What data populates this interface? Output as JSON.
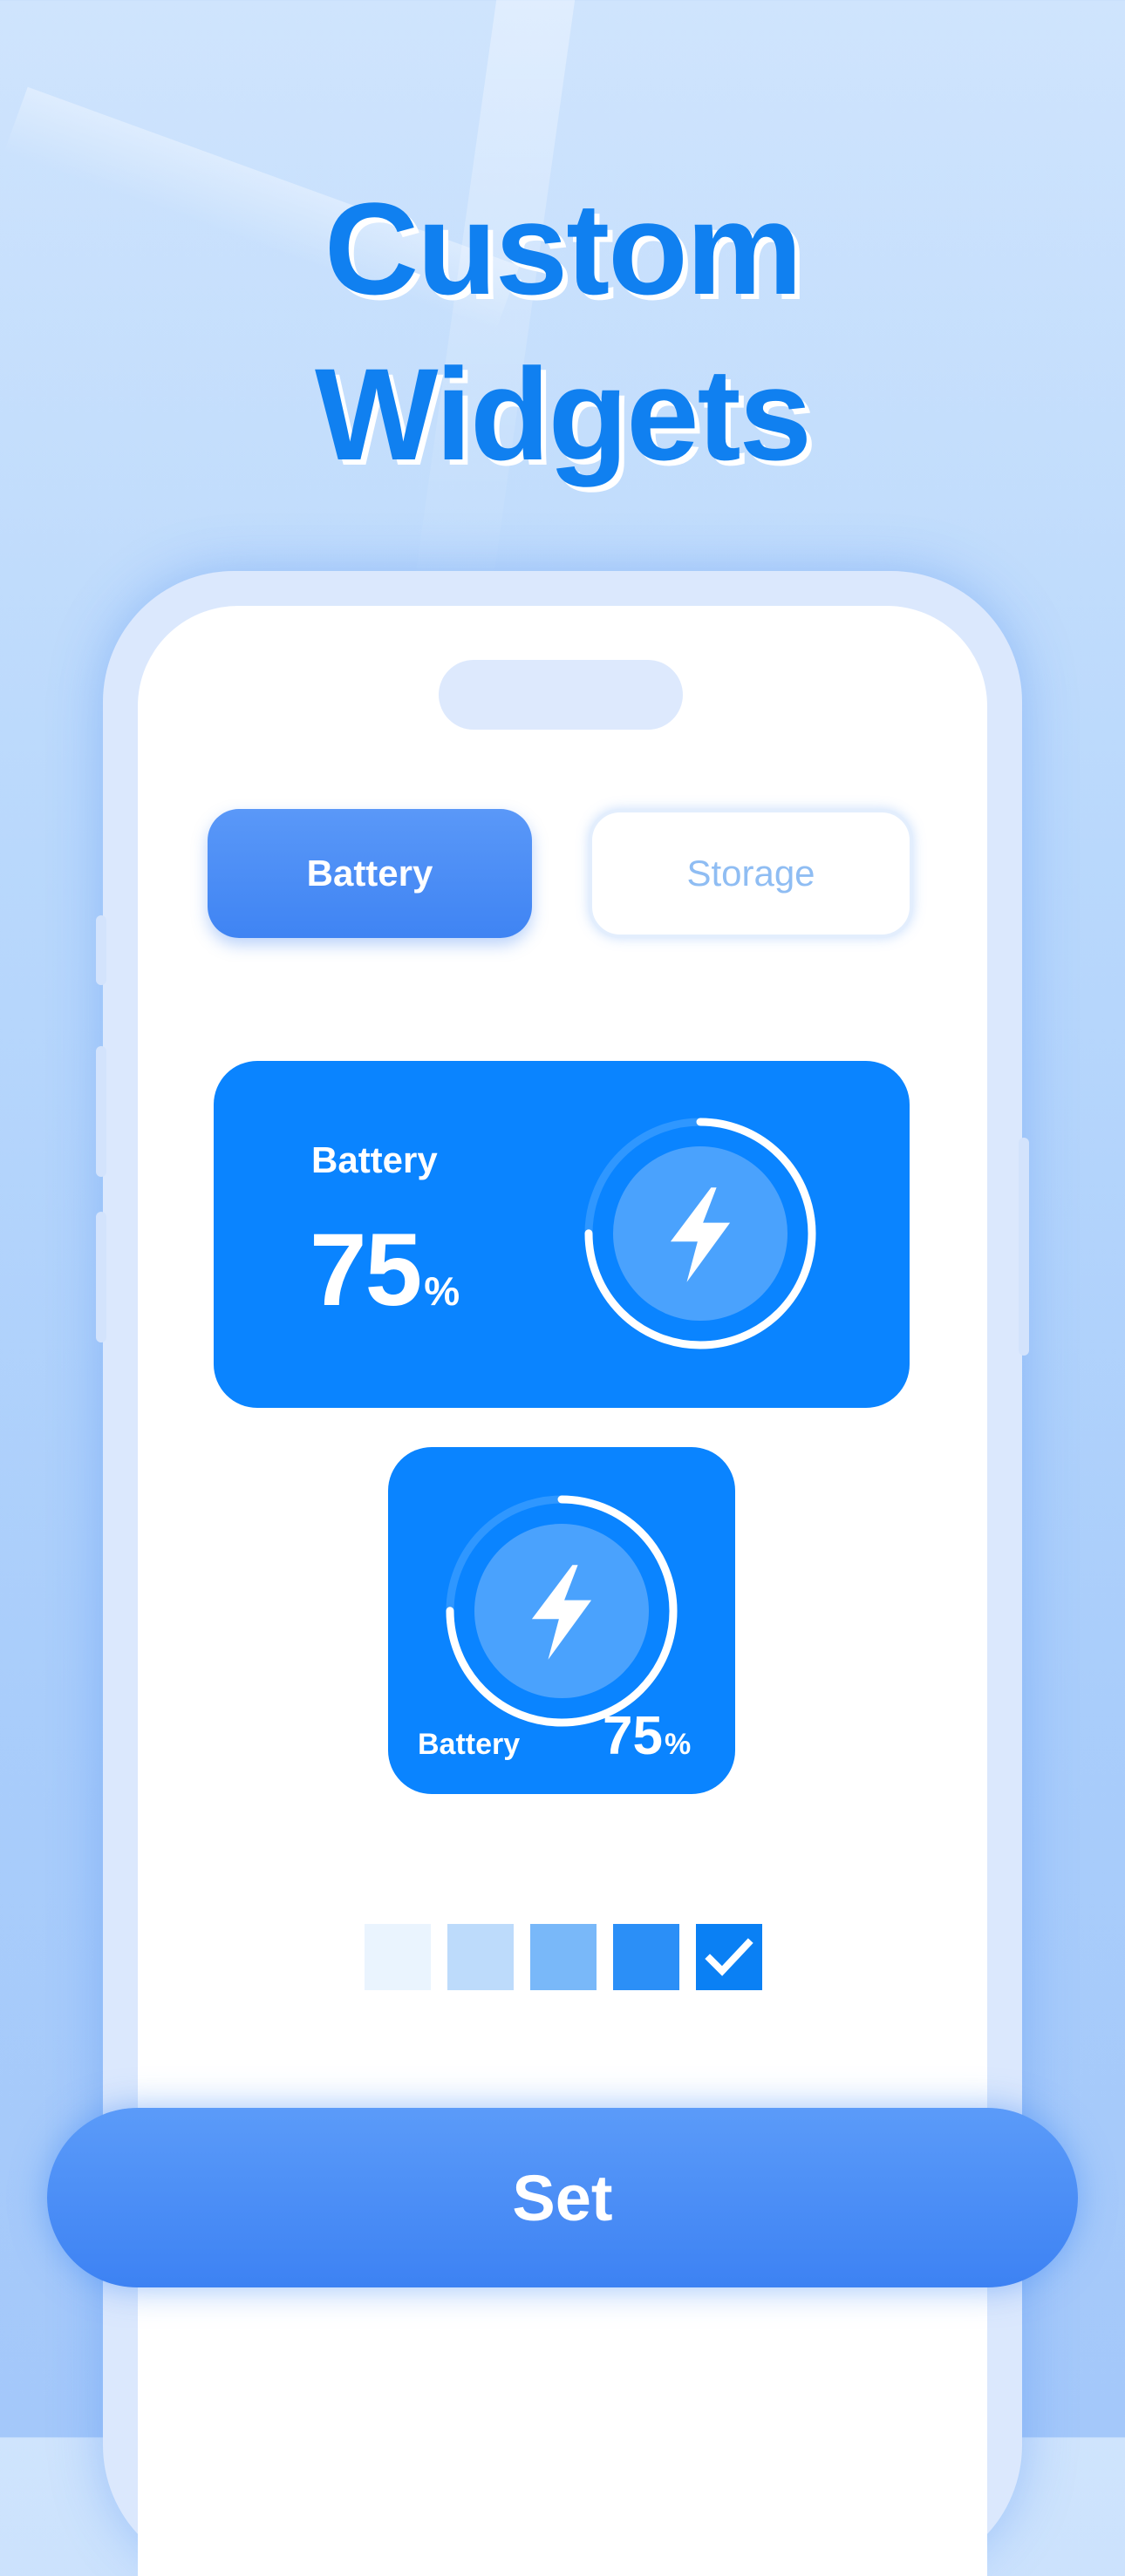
{
  "headline": {
    "line1": "Custom",
    "line2": "Widgets"
  },
  "tabs": [
    {
      "label": "Battery",
      "selected": true
    },
    {
      "label": "Storage",
      "selected": false
    }
  ],
  "widget_large": {
    "label": "Battery",
    "value": "75",
    "unit": "%"
  },
  "widget_small": {
    "label": "Battery",
    "value": "75",
    "unit": "%"
  },
  "battery_level": 0.75,
  "swatches": [
    {
      "color": "#eaf4fe",
      "selected": false
    },
    {
      "color": "#bddbfb",
      "selected": false
    },
    {
      "color": "#79b8f9",
      "selected": false
    },
    {
      "color": "#2b8ff7",
      "selected": false
    },
    {
      "color": "#0a80f4",
      "selected": true
    }
  ],
  "set_button": {
    "label": "Set"
  },
  "colors": {
    "accent": "#0a84ff",
    "headline": "#1080f0"
  }
}
